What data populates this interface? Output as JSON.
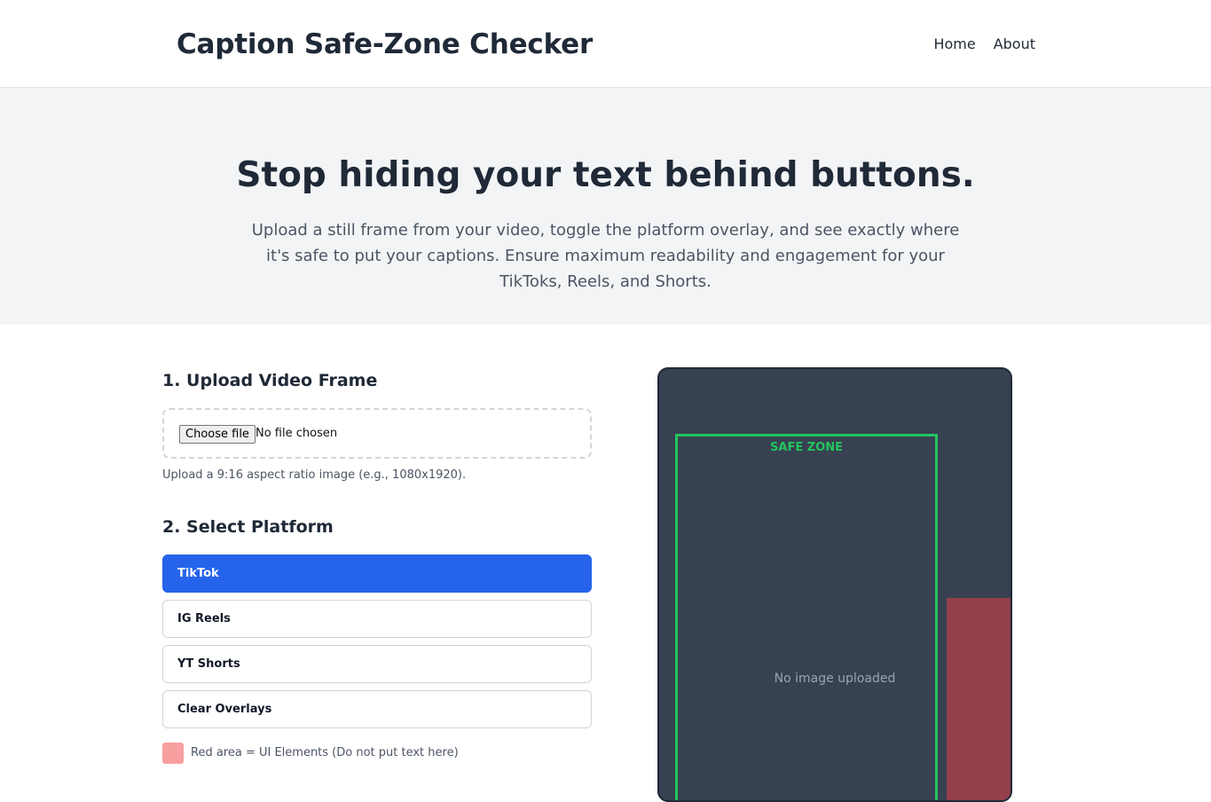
{
  "header": {
    "title": "Caption Safe-Zone Checker",
    "nav": [
      {
        "label": "Home"
      },
      {
        "label": "About"
      }
    ]
  },
  "hero": {
    "title": "Stop hiding your text behind buttons.",
    "subtitle": "Upload a still frame from your video, toggle the platform overlay, and see exactly where it's safe to put your captions. Ensure maximum readability and engagement for your TikToks, Reels, and Shorts."
  },
  "upload": {
    "heading": "1. Upload Video Frame",
    "button_label": "Choose file",
    "status": "No file chosen",
    "help": "Upload a 9:16 aspect ratio image (e.g., 1080x1920)."
  },
  "platform": {
    "heading": "2. Select Platform",
    "options": [
      {
        "label": "TikTok",
        "selected": true
      },
      {
        "label": "IG Reels",
        "selected": false
      },
      {
        "label": "YT Shorts",
        "selected": false
      },
      {
        "label": "Clear Overlays",
        "selected": false
      }
    ],
    "legend": "Red area = UI Elements (Do not put text here)"
  },
  "preview": {
    "safe_zone_label": "SAFE ZONE",
    "empty_text": "No image uploaded"
  },
  "colors": {
    "accent": "#2563eb",
    "safe_zone": "#22c55e",
    "ui_area": "#94404b",
    "legend_swatch": "#f8a0a0",
    "preview_bg": "#374151"
  }
}
